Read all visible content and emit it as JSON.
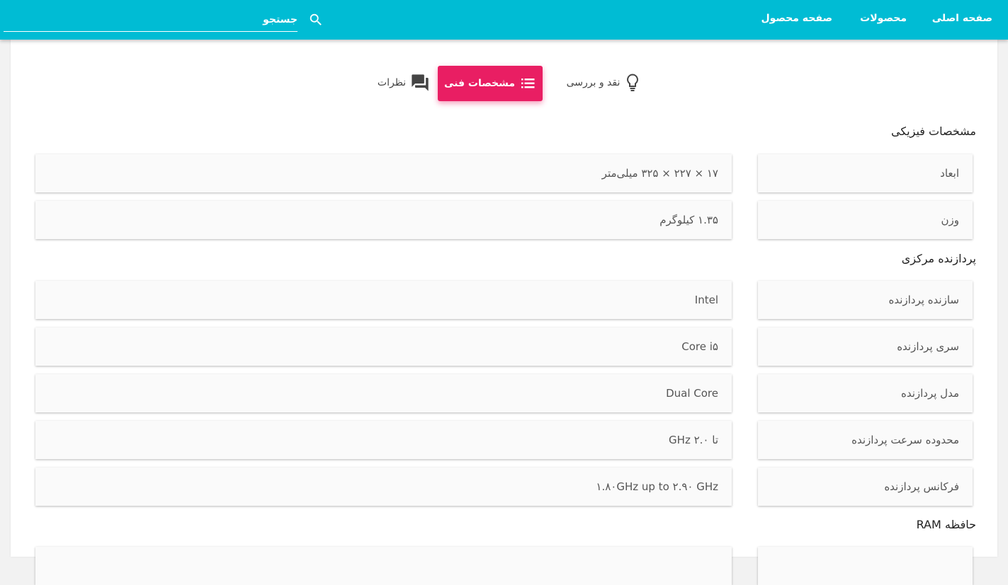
{
  "header": {
    "nav": [
      {
        "label": "صفحه اصلی"
      },
      {
        "label": "محصولات"
      },
      {
        "label": "صفحه محصول"
      }
    ],
    "search": {
      "placeholder": "جستجو",
      "icon": "search-icon"
    },
    "color": "#00bcd4"
  },
  "tabs": [
    {
      "label": "نقد و بررسی",
      "icon": "lightbulb-icon",
      "active": false
    },
    {
      "label": "مشخصات فنی",
      "icon": "list-icon",
      "active": true
    },
    {
      "label": "نظرات",
      "icon": "forum-icon",
      "active": false
    }
  ],
  "accent_color": "#e91e63",
  "sections": [
    {
      "title": "مشخصات فیزیکی",
      "rows": [
        {
          "label": "ابعاد",
          "value": "۱۷ × ۲۲۷ × ۳۲۵ میلی‌متر"
        },
        {
          "label": "وزن",
          "value": "۱.۳۵ کیلوگرم"
        }
      ]
    },
    {
      "title": "پردازنده مرکزی",
      "rows": [
        {
          "label": "سازنده پردازنده",
          "value": "Intel"
        },
        {
          "label": "سری پردازنده",
          "value": "Core i۵"
        },
        {
          "label": "مدل پردازنده",
          "value": "Dual Core"
        },
        {
          "label": "محدوده سرعت پردازنده",
          "value": "تا GHz ۲.۰"
        },
        {
          "label": "فرکانس پردازنده",
          "value": "۱.۸۰GHz up to ۲.۹۰ GHz"
        }
      ]
    },
    {
      "title": "حافظه RAM",
      "rows": [
        {
          "label": "",
          "value": ""
        }
      ]
    }
  ]
}
